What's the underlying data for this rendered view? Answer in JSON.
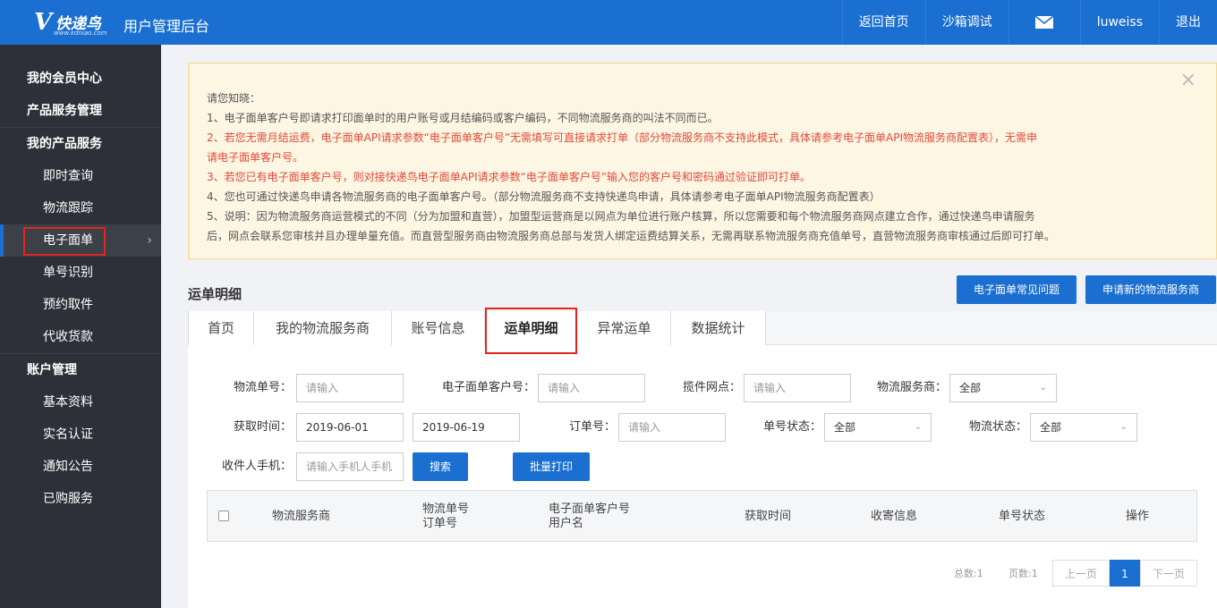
{
  "header": {
    "logo_text": "快递鸟",
    "logo_url": "www.kdniao.com",
    "app_title": "用户管理后台",
    "nav": [
      "返回首页",
      "沙箱调试",
      "luweiss",
      "退出"
    ],
    "mail_icon": "mail-icon"
  },
  "sidebar": {
    "groups": [
      {
        "label": "我的会员中心",
        "items": []
      },
      {
        "label": "产品服务管理",
        "items": []
      },
      {
        "label": "我的产品服务",
        "items": [
          "即时查询",
          "物流跟踪",
          "电子面单",
          "单号识别",
          "预约取件",
          "代收货款"
        ]
      },
      {
        "label": "账户管理",
        "items": [
          "基本资料",
          "实名认证",
          "通知公告",
          "已购服务"
        ]
      }
    ],
    "active_item": "电子面单",
    "chevron": "›"
  },
  "notice": {
    "title": "请您知晓：",
    "lines": [
      "1、电子面单客户号即请求打印面单时的用户账号或月结编码或客户编码，不同物流服务商的叫法不同而已。",
      "2、若您无需月结运费，电子面单API请求参数“电子面单客户号”无需填写可直接请求打单（部分物流服务商不支持此模式，具体请参考电子面单API物流服务商配置表），无需申",
      "请电子面单客户号。",
      "3、若您已有电子面单客户号，则对接快递鸟电子面单API请求参数“电子面单客户号”输入您的客户号和密码通过验证即可打单。",
      "4、您也可通过快递鸟申请各物流服务商的电子面单客户号。（部分物流服务商不支持快递鸟申请，具体请参考电子面单API物流服务商配置表）",
      "5、说明：因为物流服务商运营模式的不同（分为加盟和直营），加盟型运营商是以网点为单位进行账户核算，所以您需要和每个物流服务商网点建立合作，通过快递鸟申请服务",
      "后，网点会联系您审核并且办理单量充值。而直营型服务商由物流服务商总部与发货人绑定运费结算关系，无需再联系物流服务商充值单号，直营物流服务商审核通过后即可打单。"
    ],
    "close": "×",
    "red_color": "#e14a3a"
  },
  "section": {
    "title": "运单明细",
    "faq_button": "电子面单常见问题",
    "apply_button": "申请新的物流服务商"
  },
  "tabs": [
    "首页",
    "我的物流服务商",
    "账号信息",
    "运单明细",
    "异常运单",
    "数据统计"
  ],
  "active_tab": "运单明细",
  "form": {
    "tracking_no_label": "物流单号：",
    "tracking_no_placeholder": "请输入",
    "customer_no_label": "电子面单客户号：",
    "customer_no_placeholder": "请输入",
    "outlet_label": "揽件网点：",
    "outlet_placeholder": "请输入",
    "carrier_label": "物流服务商：",
    "carrier_value": "全部",
    "time_label": "获取时间：",
    "date_from": "2019-06-01",
    "date_to": "2019-06-19",
    "order_no_label": "订单号：",
    "order_no_placeholder": "请输入",
    "bill_status_label": "单号状态：",
    "bill_status_value": "全部",
    "logistics_status_label": "物流状态：",
    "logistics_status_value": "全部",
    "phone_label": "收件人手机：",
    "phone_placeholder": "请输入手机人手机",
    "search_button": "搜索",
    "batch_print_button": "批量打印"
  },
  "table": {
    "headers": {
      "carrier": "物流服务商",
      "tracking_no": "物流单号",
      "order_no": "订单号",
      "customer_no": "电子面单客户号",
      "username": "用户名",
      "time": "获取时间",
      "recipient": "收寄信息",
      "status": "单号状态",
      "action": "操作"
    }
  },
  "pagination": {
    "total": "总数:1",
    "pages": "页数:1",
    "prev": "上一页",
    "current": "1",
    "next": "下一页"
  },
  "colors": {
    "primary": "#1a6fd1",
    "sidebar_bg": "#2d3038",
    "highlight_red": "#e1251b"
  }
}
